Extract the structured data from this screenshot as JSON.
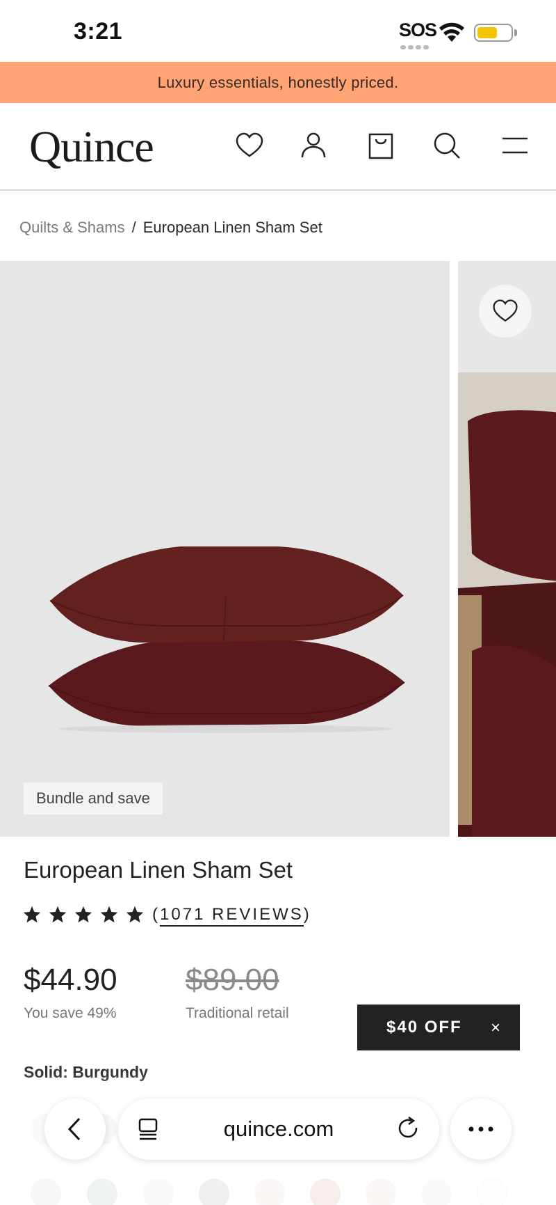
{
  "status_bar": {
    "time": "3:21",
    "sos": "SOS"
  },
  "promo_banner": {
    "text": "Luxury essentials, honestly priced."
  },
  "header": {
    "logo": "Quince",
    "icons": [
      "heart-icon",
      "account-icon",
      "bag-icon",
      "search-icon",
      "menu-icon"
    ]
  },
  "breadcrumb": {
    "parent": "Quilts & Shams",
    "separator": "/",
    "current": "European Linen Sham Set"
  },
  "gallery": {
    "badge": "Bundle and save",
    "product_color": "#5a1a1d"
  },
  "product": {
    "title": "European Linen Sham Set",
    "rating_stars": 5,
    "reviews_open": "(",
    "reviews_label": "1071 REVIEWS",
    "reviews_close": ")",
    "price": "$44.90",
    "savings": "You save 49%",
    "retail_price": "$89.00",
    "retail_label": "Traditional retail",
    "color_label": "Solid: Burgundy"
  },
  "discount_chip": {
    "label": "$40 OFF",
    "close": "×"
  },
  "browser": {
    "url": "quince.com",
    "icons": [
      "back-icon",
      "tabs-icon",
      "reload-icon",
      "more-icon"
    ]
  },
  "colors": {
    "promo_bg": "#ffa474",
    "burgundy": "#5a1a1d",
    "chip_bg": "#222222"
  }
}
